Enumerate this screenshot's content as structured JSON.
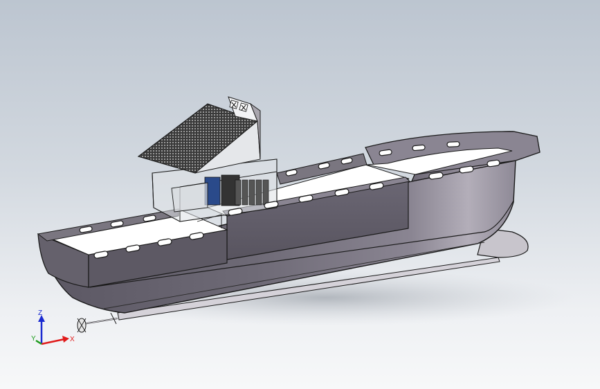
{
  "viewport": {
    "background_top": "#bcc5d0",
    "background_bottom": "#f7f8f9"
  },
  "model": {
    "hull_color": "#7d7883",
    "hull_shadow": "#4f4b56",
    "deck_color": "#ffffff",
    "panel_color": "#3d3d3d"
  },
  "triad": {
    "x_label": "X",
    "y_label": "Y",
    "z_label": "Z",
    "x_color": "#e01a1a",
    "y_color": "#1a9a1a",
    "z_color": "#1a2ad0"
  }
}
